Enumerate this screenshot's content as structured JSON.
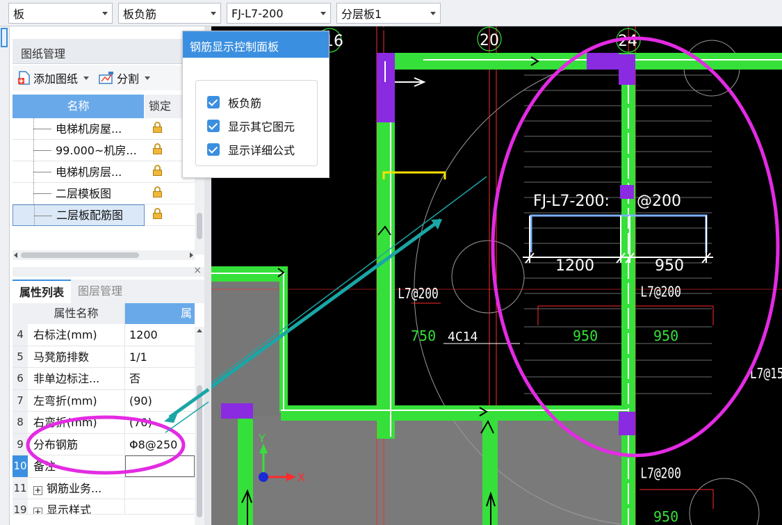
{
  "toolbar": {
    "dropdowns": [
      {
        "value": "板"
      },
      {
        "value": "板负筋"
      },
      {
        "value": "FJ-L7-200"
      },
      {
        "value": "分层板1"
      }
    ]
  },
  "drawing_panel": {
    "title": "图纸管理",
    "add_drawing_label": "添加图纸",
    "split_label": "分割",
    "columns": {
      "name": "名称",
      "lock": "锁定"
    },
    "rows": [
      {
        "name": "电梯机房屋..."
      },
      {
        "name": "99.000~机房..."
      },
      {
        "name": "电梯机房层..."
      },
      {
        "name": "二层模板图"
      },
      {
        "name": "二层板配筋图"
      }
    ]
  },
  "control_panel": {
    "title": "钢筋显示控制面板",
    "options": [
      {
        "label": "板负筋",
        "checked": true
      },
      {
        "label": "显示其它图元",
        "checked": true
      },
      {
        "label": "显示详细公式",
        "checked": true
      }
    ]
  },
  "property_panel": {
    "tabs": [
      {
        "label": "属性列表",
        "active": true
      },
      {
        "label": "图层管理",
        "active": false
      }
    ],
    "columns": {
      "name": "属性名称",
      "value": "属"
    },
    "rows": [
      {
        "index": "4",
        "name": "右标注(mm)",
        "value": "1200"
      },
      {
        "index": "5",
        "name": "马凳筋排数",
        "value": "1/1"
      },
      {
        "index": "6",
        "name": "非单边标注...",
        "value": "否"
      },
      {
        "index": "7",
        "name": "左弯折(mm)",
        "value": "(90)"
      },
      {
        "index": "8",
        "name": "右弯折(mm)",
        "value": "(70)"
      },
      {
        "index": "9",
        "name": "分布钢筋",
        "value": "Φ8@250"
      },
      {
        "index": "10",
        "name": "备注",
        "value": ""
      },
      {
        "index": "11",
        "name": "钢筋业务...",
        "value": "",
        "expandable": true
      },
      {
        "index": "19",
        "name": "显示样式",
        "value": "",
        "expandable": true
      }
    ]
  },
  "cad": {
    "axis_labels": [
      "16",
      "20",
      "24"
    ],
    "rebar_label": "FJ-L7-200:",
    "rebar_spacing": "@200",
    "dim_left": "1200",
    "dim_right": "950",
    "bar_tags": [
      "L7@200",
      "L7@200",
      "L7@200",
      "L7@15"
    ],
    "dim_tags": [
      "750",
      "950",
      "950",
      "950"
    ],
    "c14_tag": "4C14",
    "ucs": {
      "x": "X",
      "y": "Y"
    },
    "colors": {
      "beam": "#36e03a",
      "column": "#8a2be2",
      "highlight": "#e32be3",
      "leader": "#1aa6a6",
      "rebar": "#7ab0ff",
      "gridline": "#ff2a2a"
    }
  }
}
